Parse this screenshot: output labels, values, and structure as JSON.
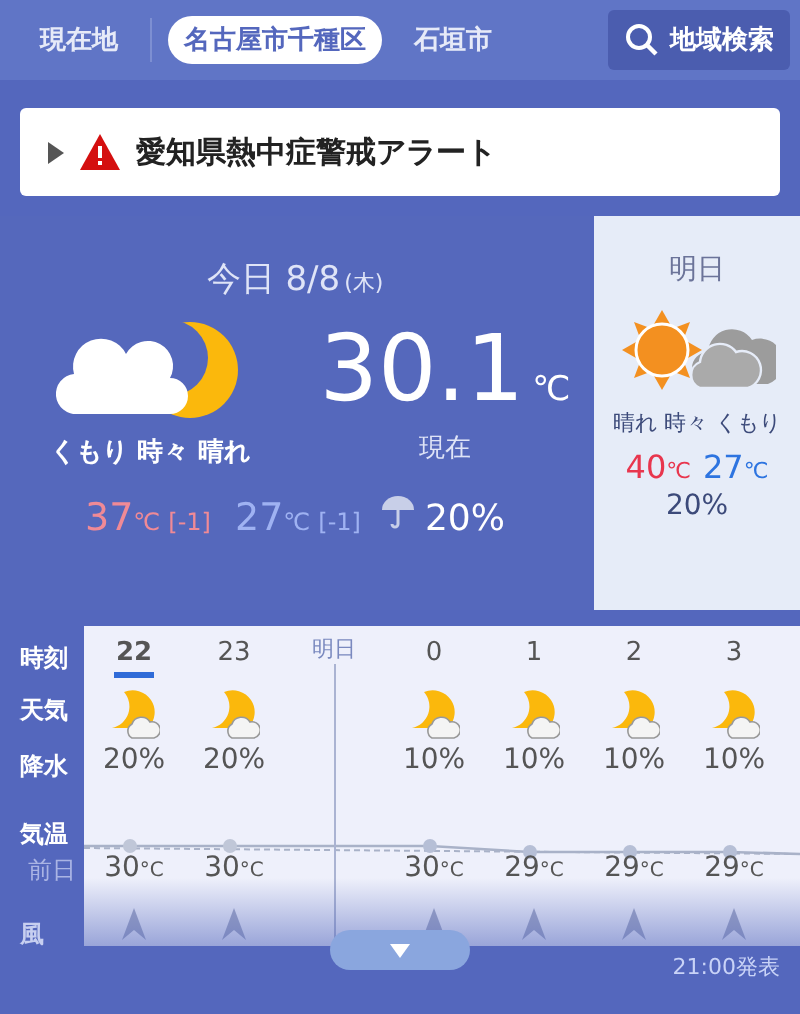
{
  "location_tabs": [
    {
      "label": "現在地",
      "selected": false
    },
    {
      "label": "名古屋市千種区",
      "selected": true
    },
    {
      "label": "石垣市",
      "selected": false
    }
  ],
  "search_button": "地域検索",
  "alert": {
    "text": "愛知県熱中症警戒アラート",
    "expanded": false
  },
  "today": {
    "title": "今日 8/8",
    "weekday": "(木)",
    "weather": "くもり 時々 晴れ",
    "current_temp": "30.1",
    "unit": "℃",
    "current_label": "現在",
    "high": "37",
    "high_unit": "℃",
    "high_diff": "[-1]",
    "low": "27",
    "low_unit": "℃",
    "low_diff": "[-1]",
    "precip": "20%"
  },
  "tomorrow": {
    "title": "明日",
    "weather": "晴れ 時々 くもり",
    "high": "40",
    "high_unit": "℃",
    "low": "27",
    "low_unit": "℃",
    "precip": "20%"
  },
  "hourly": {
    "row_labels": [
      "時刻",
      "天気",
      "降水",
      "気温",
      "前日",
      "風"
    ],
    "columns": [
      {
        "kind": "hour",
        "time": "22",
        "selected": true,
        "precip": "20%",
        "temp": "30",
        "unit": "°C"
      },
      {
        "kind": "hour",
        "time": "23",
        "selected": false,
        "precip": "20%",
        "temp": "30",
        "unit": "°C"
      },
      {
        "kind": "divider",
        "time": "明日"
      },
      {
        "kind": "hour",
        "time": "0",
        "selected": false,
        "precip": "10%",
        "temp": "30",
        "unit": "°C"
      },
      {
        "kind": "hour",
        "time": "1",
        "selected": false,
        "precip": "10%",
        "temp": "29",
        "unit": "°C"
      },
      {
        "kind": "hour",
        "time": "2",
        "selected": false,
        "precip": "10%",
        "temp": "29",
        "unit": "°C"
      },
      {
        "kind": "hour",
        "time": "3",
        "selected": false,
        "precip": "10%",
        "temp": "29",
        "unit": "°C"
      }
    ],
    "issued": "21:00発表"
  }
}
